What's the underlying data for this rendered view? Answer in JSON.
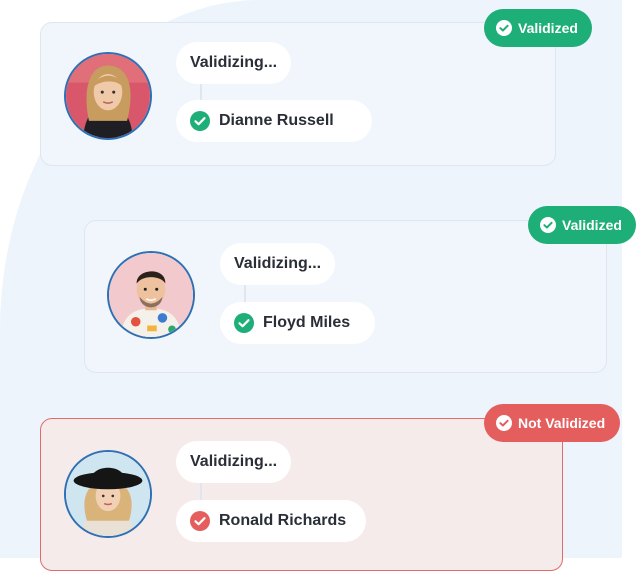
{
  "colors": {
    "success": "#1eae78",
    "error": "#e45e5e",
    "avatar_border": "#2f6fb3"
  },
  "cards": [
    {
      "status_label": "Validized",
      "status": "success",
      "progress_label": "Validizing...",
      "name": "Dianne Russell",
      "result_icon": "check-circle-icon",
      "avatar": "woman-avatar"
    },
    {
      "status_label": "Validized",
      "status": "success",
      "progress_label": "Validizing...",
      "name": "Floyd Miles",
      "result_icon": "check-circle-icon",
      "avatar": "man-avatar"
    },
    {
      "status_label": "Not Validized",
      "status": "error",
      "progress_label": "Validizing...",
      "name": "Ronald Richards",
      "result_icon": "check-circle-icon",
      "avatar": "woman-hat-avatar"
    }
  ]
}
